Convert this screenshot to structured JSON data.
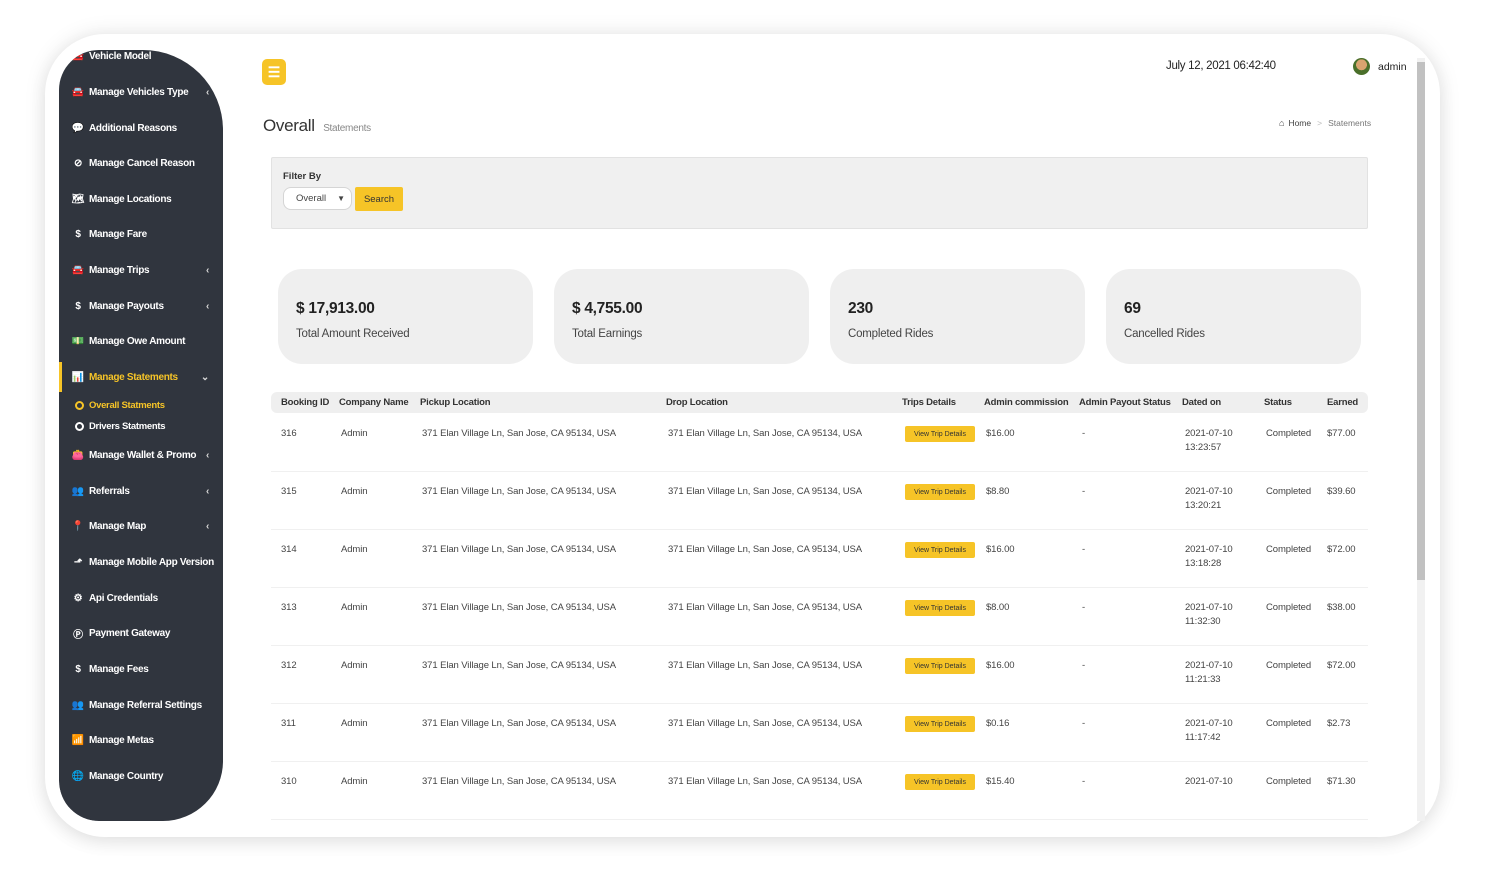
{
  "sidebar": {
    "items": [
      {
        "label": "Vehicle Model",
        "icon": "car-icon",
        "glyph": "🚘",
        "chevron": ""
      },
      {
        "label": "Manage Vehicles Type",
        "icon": "car-icon",
        "glyph": "🚘",
        "chevron": "‹"
      },
      {
        "label": "Additional Reasons",
        "icon": "comment-icon",
        "glyph": "💬",
        "chevron": ""
      },
      {
        "label": "Manage Cancel Reason",
        "icon": "ban-icon",
        "glyph": "⊘",
        "chevron": ""
      },
      {
        "label": "Manage Locations",
        "icon": "map-icon",
        "glyph": "🗺",
        "chevron": ""
      },
      {
        "label": "Manage Fare",
        "icon": "dollar-icon",
        "glyph": "$",
        "chevron": ""
      },
      {
        "label": "Manage Trips",
        "icon": "car-icon",
        "glyph": "🚘",
        "chevron": "‹"
      },
      {
        "label": "Manage Payouts",
        "icon": "dollar-icon",
        "glyph": "$",
        "chevron": "‹"
      },
      {
        "label": "Manage Owe Amount",
        "icon": "money-icon",
        "glyph": "💵",
        "chevron": ""
      },
      {
        "label": "Manage Statements",
        "icon": "area-chart-icon",
        "glyph": "📊",
        "chevron": "⌄"
      },
      {
        "label": "Manage Wallet & Promo",
        "icon": "wallet-icon",
        "glyph": "👛",
        "chevron": "‹"
      },
      {
        "label": "Referrals",
        "icon": "users-icon",
        "glyph": "👥",
        "chevron": "‹"
      },
      {
        "label": "Manage Map",
        "icon": "map-marker-icon",
        "glyph": "📍",
        "chevron": "‹"
      },
      {
        "label": "Manage Mobile App Version",
        "icon": "level-up-icon",
        "glyph": "⬏",
        "chevron": ""
      },
      {
        "label": "Api Credentials",
        "icon": "cog-icon",
        "glyph": "⚙",
        "chevron": ""
      },
      {
        "label": "Payment Gateway",
        "icon": "paypal-icon",
        "glyph": "Ⓟ",
        "chevron": ""
      },
      {
        "label": "Manage Fees",
        "icon": "dollar-icon",
        "glyph": "$",
        "chevron": ""
      },
      {
        "label": "Manage Referral Settings",
        "icon": "users-icon",
        "glyph": "👥",
        "chevron": ""
      },
      {
        "label": "Manage Metas",
        "icon": "bar-chart-icon",
        "glyph": "📶",
        "chevron": ""
      },
      {
        "label": "Manage Country",
        "icon": "globe-icon",
        "glyph": "🌐",
        "chevron": ""
      }
    ],
    "sub_items": [
      {
        "label": "Overall Statments"
      },
      {
        "label": "Drivers Statments"
      }
    ]
  },
  "header": {
    "menu_icon": "☰",
    "datetime": "July 12, 2021 06:42:40",
    "user_name": "admin"
  },
  "page": {
    "title": "Overall",
    "subtitle": "Statements",
    "breadcrumb": {
      "home_icon": "⌂",
      "home": "Home",
      "separator": ">",
      "current": "Statements"
    }
  },
  "filter": {
    "label": "Filter By",
    "selected": "Overall",
    "search_label": "Search"
  },
  "stats": [
    {
      "value": "$ 17,913.00",
      "label": "Total Amount Received"
    },
    {
      "value": "$ 4,755.00",
      "label": "Total Earnings"
    },
    {
      "value": "230",
      "label": "Completed Rides"
    },
    {
      "value": "69",
      "label": "Cancelled Rides"
    }
  ],
  "table": {
    "columns": [
      "Booking ID",
      "Company Name",
      "Pickup Location",
      "Drop Location",
      "Trips Details",
      "Admin commission",
      "Admin Payout Status",
      "Dated on",
      "Status",
      "Earned"
    ],
    "button_label": "View Trip Details",
    "rows": [
      {
        "id": "316",
        "company": "Admin",
        "pickup": "371 Elan Village Ln, San Jose, CA 95134, USA",
        "drop": "371 Elan Village Ln, San Jose, CA 95134, USA",
        "commission": "$16.00",
        "payout": "-",
        "date": "2021-07-10",
        "time": "13:23:57",
        "status": "Completed",
        "earned": "$77.00"
      },
      {
        "id": "315",
        "company": "Admin",
        "pickup": "371 Elan Village Ln, San Jose, CA 95134, USA",
        "drop": "371 Elan Village Ln, San Jose, CA 95134, USA",
        "commission": "$8.80",
        "payout": "-",
        "date": "2021-07-10",
        "time": "13:20:21",
        "status": "Completed",
        "earned": "$39.60"
      },
      {
        "id": "314",
        "company": "Admin",
        "pickup": "371 Elan Village Ln, San Jose, CA 95134, USA",
        "drop": "371 Elan Village Ln, San Jose, CA 95134, USA",
        "commission": "$16.00",
        "payout": "-",
        "date": "2021-07-10",
        "time": "13:18:28",
        "status": "Completed",
        "earned": "$72.00"
      },
      {
        "id": "313",
        "company": "Admin",
        "pickup": "371 Elan Village Ln, San Jose, CA 95134, USA",
        "drop": "371 Elan Village Ln, San Jose, CA 95134, USA",
        "commission": "$8.00",
        "payout": "-",
        "date": "2021-07-10",
        "time": "11:32:30",
        "status": "Completed",
        "earned": "$38.00"
      },
      {
        "id": "312",
        "company": "Admin",
        "pickup": "371 Elan Village Ln, San Jose, CA 95134, USA",
        "drop": "371 Elan Village Ln, San Jose, CA 95134, USA",
        "commission": "$16.00",
        "payout": "-",
        "date": "2021-07-10",
        "time": "11:21:33",
        "status": "Completed",
        "earned": "$72.00"
      },
      {
        "id": "311",
        "company": "Admin",
        "pickup": "371 Elan Village Ln, San Jose, CA 95134, USA",
        "drop": "371 Elan Village Ln, San Jose, CA 95134, USA",
        "commission": "$0.16",
        "payout": "-",
        "date": "2021-07-10",
        "time": "11:17:42",
        "status": "Completed",
        "earned": "$2.73"
      },
      {
        "id": "310",
        "company": "Admin",
        "pickup": "371 Elan Village Ln, San Jose, CA 95134, USA",
        "drop": "371 Elan Village Ln, San Jose, CA 95134, USA",
        "commission": "$15.40",
        "payout": "-",
        "date": "2021-07-10",
        "time": "",
        "status": "Completed",
        "earned": "$71.30"
      }
    ]
  },
  "colors": {
    "accent": "#f6c427",
    "sidebar_bg": "#30353e",
    "card_bg": "#efefef"
  }
}
